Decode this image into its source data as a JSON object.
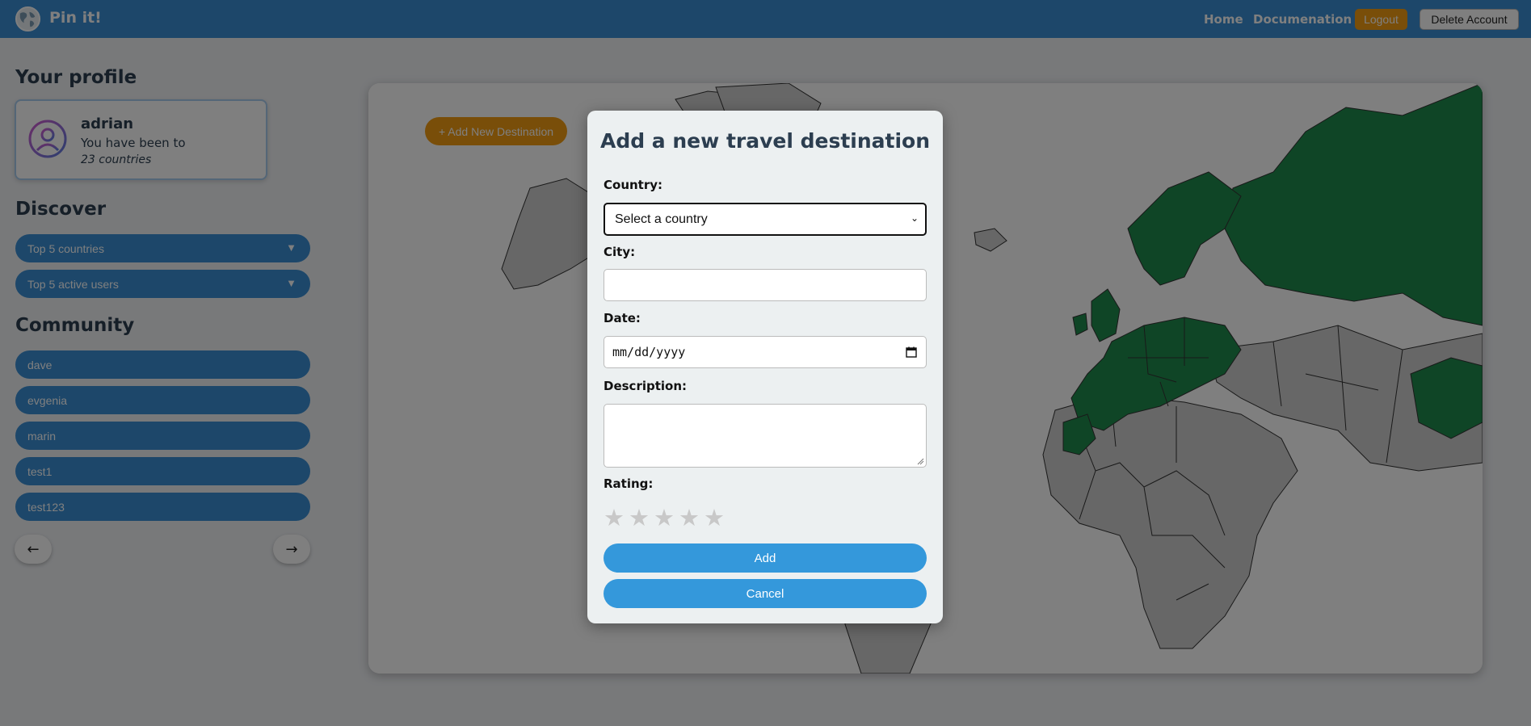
{
  "header": {
    "brand": "Pin it!",
    "nav": {
      "home": "Home",
      "docs": "Documenation"
    },
    "logout_label": "Logout",
    "delete_label": "Delete Account",
    "logo_icon": "globe-icon"
  },
  "sidebar": {
    "profile_title": "Your profile",
    "profile": {
      "name": "adrian",
      "line1": "You have been to",
      "line2": "23 countries"
    },
    "discover_title": "Discover",
    "discover_items": [
      {
        "label": "Top 5 countries"
      },
      {
        "label": "Top 5 active users"
      }
    ],
    "community_title": "Community",
    "community_users": [
      {
        "label": "dave"
      },
      {
        "label": "evgenia"
      },
      {
        "label": "marin"
      },
      {
        "label": "test1"
      },
      {
        "label": "test123"
      }
    ],
    "prev_label": "←",
    "next_label": "→"
  },
  "map": {
    "add_button": "+ Add New Destination",
    "visited_color": "#1e8a4c",
    "land_color": "#cccccc"
  },
  "modal": {
    "title": "Add a new travel destination",
    "country_label": "Country:",
    "country_value": "Select a country",
    "city_label": "City:",
    "city_value": "",
    "date_label": "Date:",
    "date_placeholder": "mm/dd/yyyy",
    "description_label": "Description:",
    "rating_label": "Rating:",
    "rating_value": 0,
    "stars": [
      "★",
      "★",
      "★",
      "★",
      "★"
    ],
    "add_label": "Add",
    "cancel_label": "Cancel"
  },
  "colors": {
    "primary": "#3a8fd4",
    "accent": "#f39c12",
    "button_blue": "#3498db"
  }
}
